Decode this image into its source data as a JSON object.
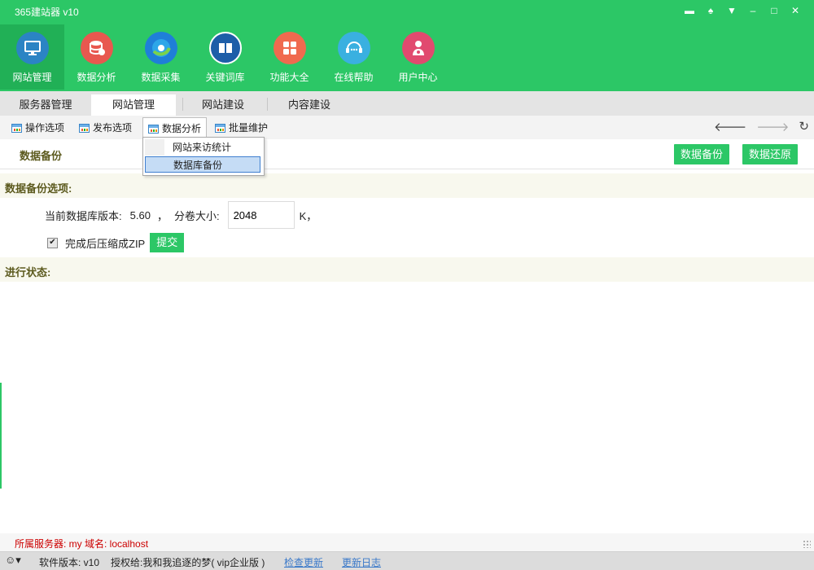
{
  "app": {
    "title": "365建站器 v10"
  },
  "window_controls": [
    "message-icon",
    "shirt-icon",
    "menu-icon",
    "minimize-icon",
    "maximize-icon",
    "close-icon"
  ],
  "nav": [
    {
      "label": "网站管理",
      "icon": "monitor-icon",
      "color": "#2b84c4",
      "active": true
    },
    {
      "label": "数据分析",
      "icon": "database-icon",
      "color": "#e8584f",
      "active": false
    },
    {
      "label": "数据采集",
      "icon": "browser-globe-icon",
      "color": "#1f7fd8",
      "active": false
    },
    {
      "label": "关键词库",
      "icon": "book-icon",
      "color": "#1d5ea8",
      "active": false
    },
    {
      "label": "功能大全",
      "icon": "grid-icon",
      "color": "#f06a4f",
      "active": false
    },
    {
      "label": "在线帮助",
      "icon": "headset-icon",
      "color": "#3ab0e0",
      "active": false
    },
    {
      "label": "用户中心",
      "icon": "user-icon",
      "color": "#e14a6f",
      "active": false
    }
  ],
  "tabs": [
    {
      "label": "服务器管理",
      "active": false
    },
    {
      "label": "网站管理",
      "active": true
    },
    {
      "label": "网站建设",
      "active": false
    },
    {
      "label": "内容建设",
      "active": false
    }
  ],
  "toolbar": [
    {
      "label": "操作选项"
    },
    {
      "label": "发布选项"
    },
    {
      "label": "数据分析",
      "open": true
    },
    {
      "label": "批量维护"
    }
  ],
  "dropdown": [
    {
      "label": "网站来访统计",
      "selected": false
    },
    {
      "label": "数据库备份",
      "selected": true
    }
  ],
  "header": {
    "title": "数据备份",
    "btn_backup": "数据备份",
    "btn_restore": "数据还原"
  },
  "backup": {
    "section_title": "数据备份选项:",
    "version_label": "当前数据库版本:",
    "version_value": "5.60",
    "sep": "，",
    "volume_label": "分卷大小:",
    "volume_value": "2048",
    "volume_unit": "K，",
    "zip_label": "完成后压缩成ZIP",
    "zip_checked": true,
    "submit": "提交"
  },
  "progress": {
    "section_title": "进行状态:"
  },
  "server_line": "所属服务器: my 域名: localhost",
  "statusbar": {
    "version": "软件版本: v10",
    "license": "授权给:我和我追逐的梦( vip企业版 )",
    "check_update": "检查更新",
    "update_log": "更新日志"
  },
  "colors": {
    "brand_green": "#2cc766",
    "accent_text": "#5c5a1e",
    "server_text": "#cc0000"
  }
}
